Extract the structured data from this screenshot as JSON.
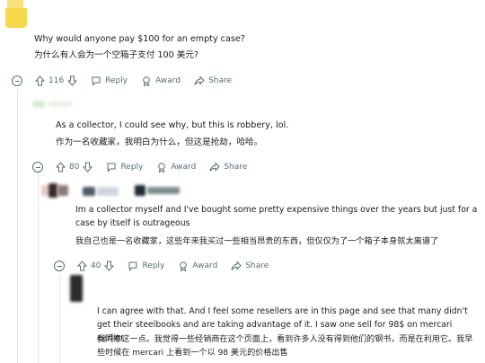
{
  "posts": [
    {
      "text_en": "Why would anyone pay $100 for an empty case?",
      "text_zh": "为什么有人会为一个空箱子支付 100 美元?",
      "votes": "116",
      "reply_label": "Reply",
      "award_label": "Award",
      "share_label": "Share"
    },
    {
      "text_en": "As a collector, I could see why, but this is robbery, lol.",
      "text_zh": "作为一名收藏家，我明白为什么，但这是抢劫，哈哈。",
      "votes": "80",
      "reply_label": "Reply",
      "award_label": "Award",
      "share_label": "Share"
    },
    {
      "text_en": "Im a collector myself and I've bought some pretty expensive things over the years but just for a case by itself is outrageous",
      "text_zh": "我自己也是一名收藏家，这些年来我买过一些相当昂贵的东西，但仅仅为了一个箱子本身就太离谱了",
      "votes": "40",
      "reply_label": "Reply",
      "award_label": "Award",
      "share_label": "Share"
    },
    {
      "text_en": "I can agree with that. And I feel some resellers are in this page and see that many didn't get their steelbooks and are taking advantage of it. I saw one sell for 98$ on mercari earlier",
      "text_zh": "我同意这一点。我觉得一些经销商在这个页面上，看到许多人没有得到他们的钢书，而是在利用它。我早些时候在 mercari 上看到一个以 98 美元的价格出售"
    }
  ],
  "colors": {
    "avatar_yellow": "#f6d94a",
    "meta_text": "#576f76",
    "thread_line": "#e3e6e8"
  },
  "icons": [
    "upvote-icon",
    "downvote-icon",
    "reply-icon",
    "award-icon",
    "share-icon",
    "collapse-icon"
  ]
}
